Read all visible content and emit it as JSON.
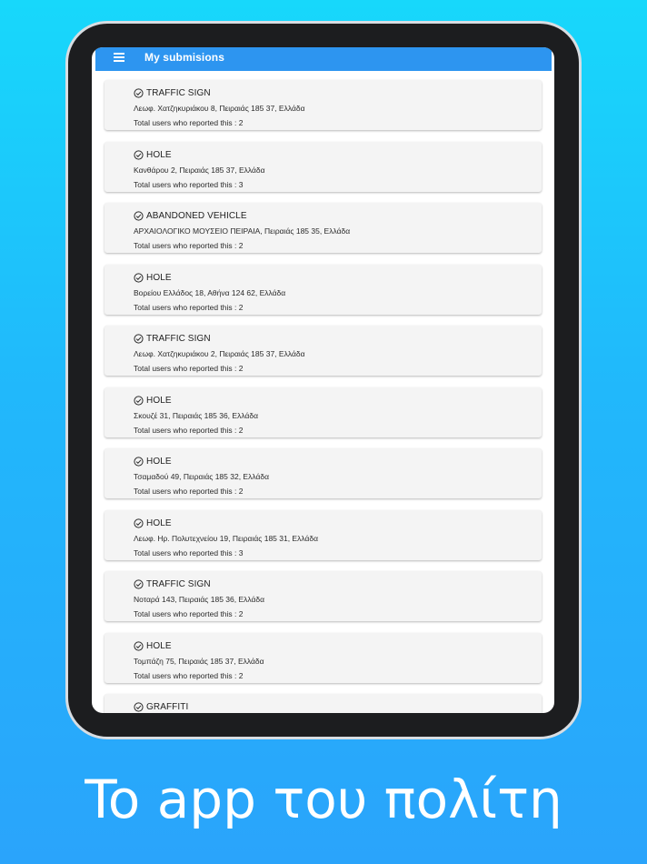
{
  "appbar": {
    "title": "My submisions",
    "menu_icon": "hamburger-menu-icon",
    "color": "#2d95f0"
  },
  "count_label": "Total users who reported this :",
  "submissions": [
    {
      "type": "TRAFFIC SIGN",
      "address": "Λεωφ. Χατζηκυριάκου 8, Πειραιάς 185 37, Ελλάδα",
      "count": "2"
    },
    {
      "type": "HOLE",
      "address": "Κανθάρου 2, Πειραιάς 185 37, Ελλάδα",
      "count": "3"
    },
    {
      "type": "ABANDONED VEHICLE",
      "address": "ΑΡΧΑΙΟΛΟΓΙΚΟ ΜΟΥΣΕΙΟ ΠΕΙΡΑΙΑ, Πειραιάς 185 35, Ελλάδα",
      "count": "2"
    },
    {
      "type": "HOLE",
      "address": "Βορείου Ελλάδος 18, Αθήνα 124 62, Ελλάδα",
      "count": "2"
    },
    {
      "type": "TRAFFIC SIGN",
      "address": "Λεωφ. Χατζηκυριάκου 2, Πειραιάς 185 37, Ελλάδα",
      "count": "2"
    },
    {
      "type": "HOLE",
      "address": "Σκουζέ 31, Πειραιάς 185 36, Ελλάδα",
      "count": "2"
    },
    {
      "type": "HOLE",
      "address": "Τσαμαδού 49, Πειραιάς 185 32, Ελλάδα",
      "count": "2"
    },
    {
      "type": "HOLE",
      "address": "Λεωφ. Ηρ. Πολυτεχνείου 19, Πειραιάς 185 31, Ελλάδα",
      "count": "3"
    },
    {
      "type": "TRAFFIC SIGN",
      "address": "Νοταρά 143, Πειραιάς 185 36, Ελλάδα",
      "count": "2"
    },
    {
      "type": "HOLE",
      "address": "Τομπάζη 75, Πειραιάς 185 37, Ελλάδα",
      "count": "2"
    },
    {
      "type": "GRAFFITI",
      "address": "",
      "count": ""
    }
  ],
  "status_icon": "check-circle-icon",
  "tagline": "To app του πολίτη"
}
